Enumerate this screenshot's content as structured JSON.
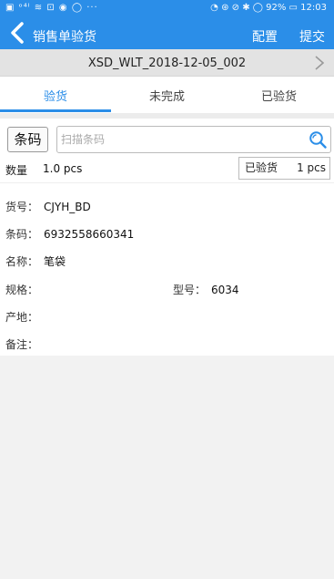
{
  "status_bar": {
    "left_icons": "▣ ᵒ⁴ᴵ ≋ ⊡ ◉ ◯ ···",
    "right_icons": "◔ ⊛ ⊘ ✱ ◯ 92% ▭",
    "time": "12:03"
  },
  "header": {
    "title": "销售单验货",
    "config_label": "配置",
    "submit_label": "提交"
  },
  "document": {
    "number": "XSD_WLT_2018-12-05_002"
  },
  "tabs": [
    {
      "label": "验货",
      "active": true
    },
    {
      "label": "未完成",
      "active": false
    },
    {
      "label": "已验货",
      "active": false
    }
  ],
  "scan": {
    "label": "条码",
    "placeholder": "扫描条码",
    "value": ""
  },
  "quantity": {
    "label": "数量",
    "value": "1.0 pcs"
  },
  "checked": {
    "label": "已验货",
    "value": "1 pcs"
  },
  "detail": {
    "item_no_label": "货号：",
    "item_no": "CJYH_BD",
    "barcode_label": "条码：",
    "barcode": "6932558660341",
    "name_label": "名称：",
    "name": "笔袋",
    "spec_label": "规格：",
    "spec": "",
    "model_label": "型号：",
    "model": "6034",
    "origin_label": "产地：",
    "origin": "",
    "remark_label": "备注：",
    "remark": ""
  },
  "colors": {
    "accent": "#2b8ee8"
  }
}
